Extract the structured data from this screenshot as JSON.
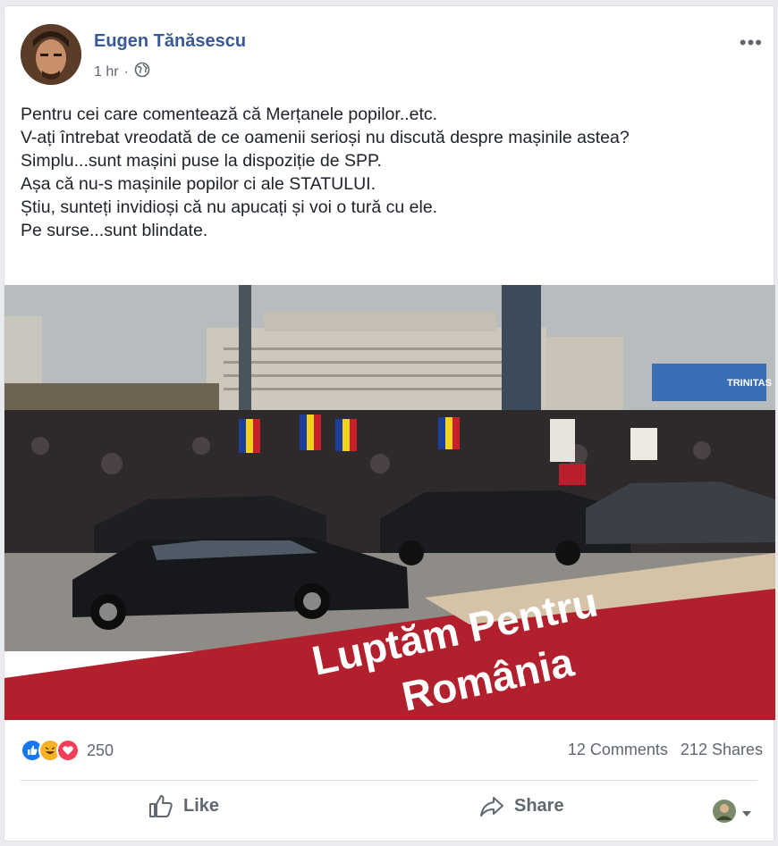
{
  "post": {
    "author": "Eugen Tănăsescu",
    "time": "1 hr",
    "separator": "·",
    "more_label": "•••",
    "lines": [
      "Pentru cei care comentează că Merțanele popilor..etc.",
      "V-ați întrebat vreodată de ce oamenii serioși nu discută despre mașinile astea?",
      "Simplu...sunt mașini puse la dispoziție de SPP.",
      "Așa că nu-s mașinile popilor ci ale STATULUI.",
      "Știu, sunteți invidioși că nu apucați și voi o tură cu ele.",
      "Pe surse...sunt blindate."
    ],
    "image_overlay": {
      "line1": "Luptăm Pentru",
      "line2": "România"
    },
    "banner_text": "TRINITAS"
  },
  "stats": {
    "reaction_count": "250",
    "comments": "12 Comments",
    "shares": "212 Shares"
  },
  "actions": {
    "like": "Like",
    "share": "Share"
  },
  "colors": {
    "link": "#385898",
    "like_blue": "#1877f2",
    "haha_yellow": "#f7b125",
    "love_red": "#f33e58"
  }
}
